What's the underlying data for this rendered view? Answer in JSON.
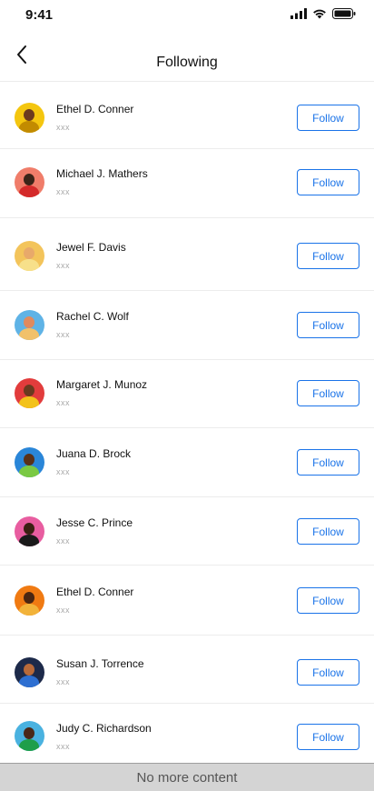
{
  "status_bar": {
    "time": "9:41"
  },
  "header": {
    "title": "Following",
    "back_icon": "chevron-left-icon"
  },
  "following": [
    {
      "name": "Ethel D. Conner",
      "subtitle": "xxx",
      "button": "Follow",
      "avatar_bg": "#f4c60f",
      "avatar_head": "#6b3a1f",
      "avatar_body": "#c28b00"
    },
    {
      "name": "Michael J. Mathers",
      "subtitle": "xxx",
      "button": "Follow",
      "avatar_bg": "#f07d6a",
      "avatar_head": "#3b2418",
      "avatar_body": "#d42a2a"
    },
    {
      "name": "Jewel F. Davis",
      "subtitle": "xxx",
      "button": "Follow",
      "avatar_bg": "#f3c45b",
      "avatar_head": "#e8a96a",
      "avatar_body": "#f7e08a"
    },
    {
      "name": "Rachel C. Wolf",
      "subtitle": "xxx",
      "button": "Follow",
      "avatar_bg": "#5fb3e6",
      "avatar_head": "#e08a5e",
      "avatar_body": "#f1c16a"
    },
    {
      "name": "Margaret J. Munoz",
      "subtitle": "xxx",
      "button": "Follow",
      "avatar_bg": "#e23c3c",
      "avatar_head": "#6a3a1f",
      "avatar_body": "#f3c21a"
    },
    {
      "name": "Juana D. Brock",
      "subtitle": "xxx",
      "button": "Follow",
      "avatar_bg": "#2a86d8",
      "avatar_head": "#5a3118",
      "avatar_body": "#7ac943"
    },
    {
      "name": "Jesse C. Prince",
      "subtitle": "xxx",
      "button": "Follow",
      "avatar_bg": "#e85da0",
      "avatar_head": "#3a2012",
      "avatar_body": "#1a1a1a"
    },
    {
      "name": "Ethel D. Conner",
      "subtitle": "xxx",
      "button": "Follow",
      "avatar_bg": "#f07a12",
      "avatar_head": "#4a2612",
      "avatar_body": "#f2b33a"
    },
    {
      "name": "Susan J. Torrence",
      "subtitle": "xxx",
      "button": "Follow",
      "avatar_bg": "#1d2a4a",
      "avatar_head": "#b86a3a",
      "avatar_body": "#2e6fd1"
    },
    {
      "name": "Judy C. Richardson",
      "subtitle": "xxx",
      "button": "Follow",
      "avatar_bg": "#4ab2e0",
      "avatar_head": "#4a2818",
      "avatar_body": "#1e9e4a"
    }
  ],
  "footer": {
    "text": "No more content"
  },
  "colors": {
    "accent": "#1a73e8",
    "divider": "#ececec",
    "footer_bg": "#d4d4d4"
  }
}
